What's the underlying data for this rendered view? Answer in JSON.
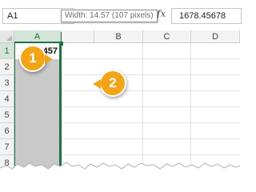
{
  "formula_bar": {
    "name_box": "A1",
    "fx": "fx",
    "formula_value": "1678.45678",
    "cancel_glyph": "×",
    "enter_glyph": "✓"
  },
  "tooltip": {
    "text": "Width: 14.57 (107 pixels)"
  },
  "columns": {
    "a": "A",
    "b": "B",
    "c": "C",
    "d": "D"
  },
  "rows": [
    "1",
    "2",
    "3",
    "4",
    "5",
    "6",
    "7",
    "8"
  ],
  "cells": {
    "a1": "457"
  },
  "markers": {
    "one": "1",
    "two": "2"
  },
  "colors": {
    "accent_green": "#217346",
    "callout_orange": "#f2a417",
    "selection_gray": "#c9c9c9"
  }
}
